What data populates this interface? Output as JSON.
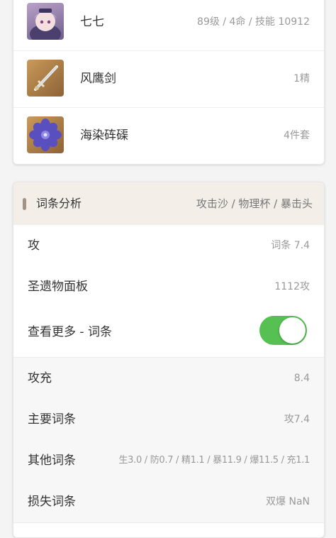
{
  "items": [
    {
      "name": "七七",
      "meta": "89级 / 4命 / 技能 10912",
      "icon": "character-portrait-icon"
    },
    {
      "name": "风鹰剑",
      "meta": "1精",
      "icon": "sword-icon"
    },
    {
      "name": "海染砗磲",
      "meta": "4件套",
      "icon": "artifact-flower-icon"
    }
  ],
  "section": {
    "title": "词条分析",
    "subtitle": "攻击沙 / 物理杯 / 暴击头"
  },
  "rows": {
    "atk": {
      "label": "攻",
      "value": "词条 7.4"
    },
    "panel": {
      "label": "圣遗物面板",
      "value": "1112攻"
    },
    "more": {
      "label": "查看更多 - 词条",
      "toggle_on": true
    },
    "atk_fill": {
      "label": "攻充",
      "value": "8.4"
    },
    "main": {
      "label": "主要词条",
      "value": "攻7.4"
    },
    "other": {
      "label": "其他词条",
      "value": "生3.0 / 防0.7 / 精1.1 / 暴11.9 / 爆11.5 / 充1.1"
    },
    "lost": {
      "label": "损失词条",
      "value": "双爆 NaN"
    }
  },
  "colors": {
    "toggle_on": "#56c152",
    "section_header": "#f3eee8",
    "accent_bar": "#a49382"
  }
}
